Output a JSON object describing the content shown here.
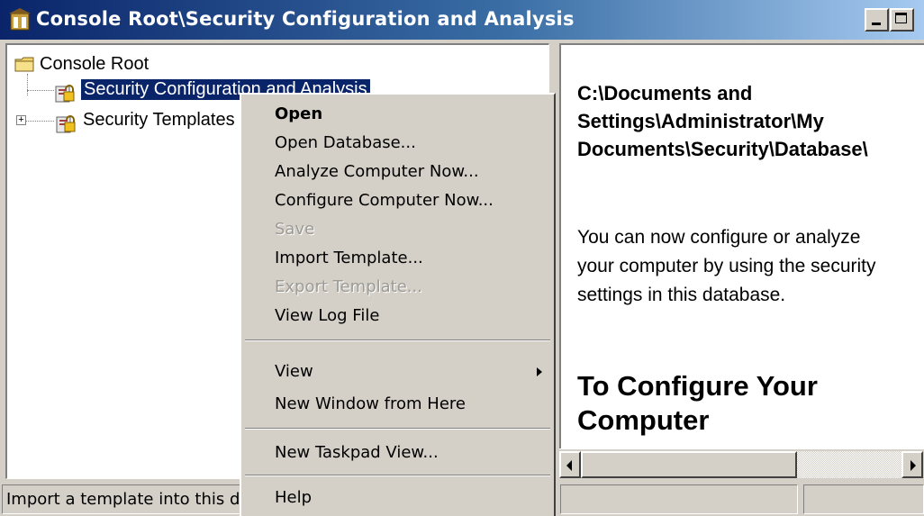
{
  "window": {
    "title": "Console Root\\Security Configuration and Analysis",
    "icon": "mmc-console-icon"
  },
  "tree": {
    "root_label": "Console Root",
    "items": [
      {
        "label": "Security Configuration and Analysis",
        "icon": "security-lock-icon",
        "selected": true
      },
      {
        "label": "Security Templates",
        "icon": "security-lock-icon",
        "expandable": true
      }
    ]
  },
  "right_pane": {
    "db_path_lines": [
      "C:\\Documents and",
      "Settings\\Administrator\\My",
      "Documents\\Security\\Database\\"
    ],
    "description": "You can now configure or analyze your computer by using the security settings in this database.",
    "heading": "To Configure Your Computer"
  },
  "context_menu": {
    "items": [
      {
        "label": "Open",
        "bold": true
      },
      {
        "label": "Open Database..."
      },
      {
        "label": "Analyze Computer Now..."
      },
      {
        "label": "Configure Computer Now..."
      },
      {
        "label": "Save",
        "disabled": true
      },
      {
        "label": "Import Template..."
      },
      {
        "label": "Export Template...",
        "disabled": true
      },
      {
        "label": "View Log File"
      },
      {
        "label": "View",
        "submenu": true
      },
      {
        "label": "New Window from Here"
      },
      {
        "label": "New Taskpad View..."
      },
      {
        "label": "Help"
      }
    ]
  },
  "statusbar": {
    "text": "Import a template into this database"
  }
}
